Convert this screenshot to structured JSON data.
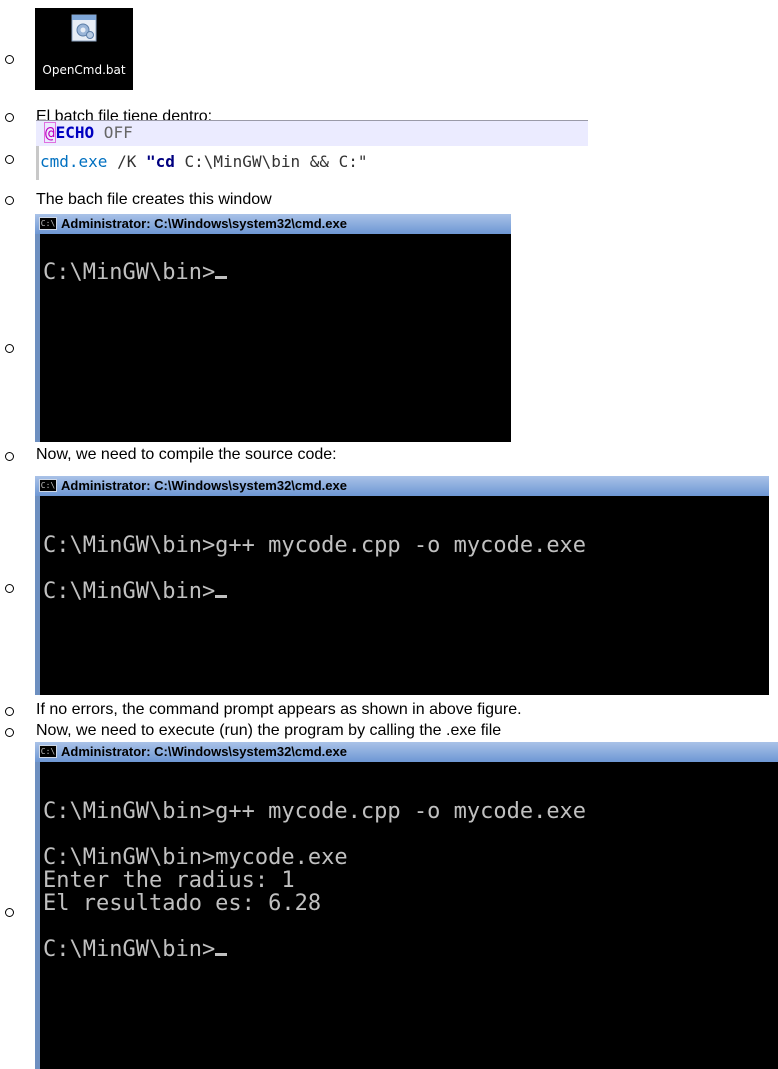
{
  "desktop_icon": {
    "label": "OpenCmd.bat",
    "icon": "batch-file-icon"
  },
  "bullets": {
    "batch_intro": "El batch file tiene dentro:",
    "window_intro": "The bach file creates this window",
    "compile_intro": "Now, we need to compile the source code:",
    "no_errors": "If no errors, the command prompt appears as shown in above figure.",
    "execute_intro": "Now, we need to execute (run) the program by calling the .exe file"
  },
  "code": {
    "line1_at": "@",
    "line1_echo": "ECHO",
    "line1_off": " OFF",
    "line2_cmd": "cmd.exe",
    "line2_k": " /K ",
    "line2_q1": "\"",
    "line2_cd": "cd",
    "line2_rest": " C:\\MinGW\\bin && C:",
    "line2_q2": "\""
  },
  "window_title": "Administrator: C:\\Windows\\system32\\cmd.exe",
  "window_icon": "console-icon",
  "console1": {
    "lines": [
      "C:\\MinGW\\bin>"
    ]
  },
  "console2": {
    "lines": [
      "C:\\MinGW\\bin>g++ mycode.cpp -o mycode.exe",
      "",
      "C:\\MinGW\\bin>"
    ]
  },
  "console3": {
    "lines": [
      "C:\\MinGW\\bin>g++ mycode.cpp -o mycode.exe",
      "",
      "C:\\MinGW\\bin>mycode.exe",
      "Enter the radius: 1",
      "El resultado es: 6.28",
      "",
      "C:\\MinGW\\bin>"
    ]
  },
  "colors": {
    "titlebar": "#6d97d4",
    "console_bg": "#000000",
    "console_text": "#c0c0c0"
  }
}
